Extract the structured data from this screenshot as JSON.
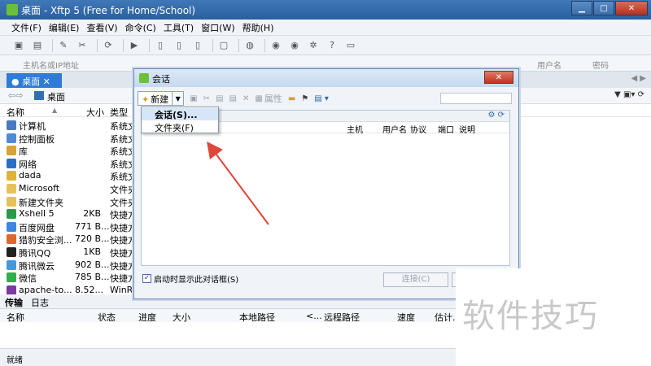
{
  "window": {
    "title": "桌面 - Xftp 5 (Free for Home/School)"
  },
  "menu": [
    "文件(F)",
    "编辑(E)",
    "查看(V)",
    "命令(C)",
    "工具(T)",
    "窗口(W)",
    "帮助(H)"
  ],
  "address": {
    "host_placeholder": "主机名或IP地址",
    "username_label": "用户名",
    "password_label": "密码"
  },
  "tab": {
    "label": "桌面"
  },
  "local": {
    "path": "桌面",
    "columns": {
      "name": "名称",
      "size": "大小",
      "type": "类型"
    },
    "files": [
      {
        "name": "计算机",
        "size": "",
        "type": "系统文",
        "color": "#4a78c2"
      },
      {
        "name": "控制面板",
        "size": "",
        "type": "系统文",
        "color": "#4f8bd4"
      },
      {
        "name": "库",
        "size": "",
        "type": "系统文",
        "color": "#d8a437"
      },
      {
        "name": "网络",
        "size": "",
        "type": "系统文",
        "color": "#2b6fc4"
      },
      {
        "name": "dada",
        "size": "",
        "type": "系统文",
        "color": "#e2b13a"
      },
      {
        "name": "Microsoft",
        "size": "",
        "type": "文件夹",
        "color": "#e6c25a"
      },
      {
        "name": "新建文件夹",
        "size": "",
        "type": "文件夹",
        "color": "#e6c25a"
      },
      {
        "name": "Xshell 5",
        "size": "2KB",
        "type": "快捷方",
        "color": "#2c9a4a"
      },
      {
        "name": "百度网盘",
        "size": "771 B...",
        "type": "快捷方",
        "color": "#3f86e0"
      },
      {
        "name": "猎豹安全浏...",
        "size": "720 B...",
        "type": "快捷方",
        "color": "#e0672a"
      },
      {
        "name": "腾讯QQ",
        "size": "1KB",
        "type": "快捷方",
        "color": "#222222"
      },
      {
        "name": "腾讯微云",
        "size": "902 B...",
        "type": "快捷方",
        "color": "#3f9ae0"
      },
      {
        "name": "微信",
        "size": "785 B...",
        "type": "快捷方",
        "color": "#2fb04a"
      },
      {
        "name": "apache-to...",
        "size": "8.52...",
        "type": "WinR...",
        "color": "#7a3aa0"
      }
    ]
  },
  "transfer": {
    "tab_active": "传输",
    "tab_other": "日志",
    "columns": [
      "名称",
      "状态",
      "进度",
      "大小",
      "本地路径",
      "<...",
      "远程路径",
      "速度",
      "估计..."
    ],
    "status": "就绪"
  },
  "dialog": {
    "title": "会话",
    "new_button": "新建",
    "properties_label": "属性",
    "columns": [
      "主机",
      "用户名",
      "协议",
      "端口",
      "说明"
    ],
    "dropdown": {
      "session": "会话(S)...",
      "folder": "文件夹(F)"
    },
    "startup_checkbox": "启动时显示此对话框(S)",
    "startup_checked": true,
    "connect_button": "连接(C)"
  },
  "watermark": "软件技巧"
}
